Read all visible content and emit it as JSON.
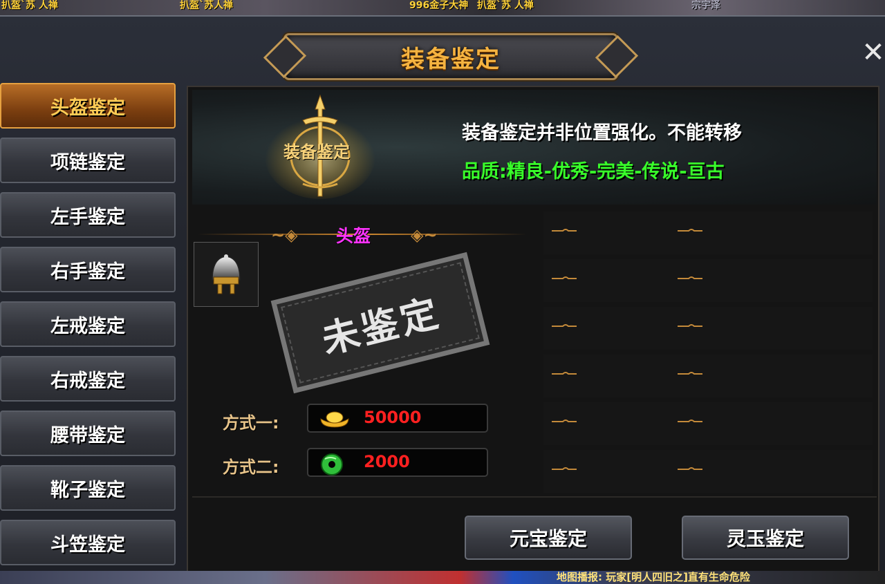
{
  "top_strip": {
    "names": [
      "扒盔`苏 人禅",
      "扒盔`苏人禅",
      "996金子大神",
      "扒盔`苏 人禅",
      "宗宇泽"
    ]
  },
  "window": {
    "title": "装备鉴定"
  },
  "sidebar": {
    "items": [
      {
        "label": "头盔鉴定",
        "active": true
      },
      {
        "label": "项链鉴定",
        "active": false
      },
      {
        "label": "左手鉴定",
        "active": false
      },
      {
        "label": "右手鉴定",
        "active": false
      },
      {
        "label": "左戒鉴定",
        "active": false
      },
      {
        "label": "右戒鉴定",
        "active": false
      },
      {
        "label": "腰带鉴定",
        "active": false
      },
      {
        "label": "靴子鉴定",
        "active": false
      },
      {
        "label": "斗笠鉴定",
        "active": false
      }
    ]
  },
  "banner": {
    "emblem_label": "装备鉴定",
    "description": "装备鉴定并非位置强化。不能转移",
    "quality_chain": "品质:精良-优秀-完美-传说-亘古"
  },
  "item": {
    "slot_name": "头盔",
    "icon": "helmet-icon",
    "status_stamp": "未鉴定"
  },
  "costs": [
    {
      "label": "方式一:",
      "icon": "gold-ingot-icon",
      "value": "50000"
    },
    {
      "label": "方式二:",
      "icon": "jade-icon",
      "value": "2000"
    }
  ],
  "actions": {
    "gold_label": "元宝鉴定",
    "jade_label": "灵玉鉴定"
  },
  "bottom_strip": {
    "broadcast": "地图播报: 玩家[明人四旧之]直有生命危险"
  },
  "colors": {
    "title": "#f5b340",
    "active_tab": "#ffcc55",
    "quality": "#38ff2a",
    "slot_name": "#ff33ff",
    "cost_value": "#ff2020"
  }
}
